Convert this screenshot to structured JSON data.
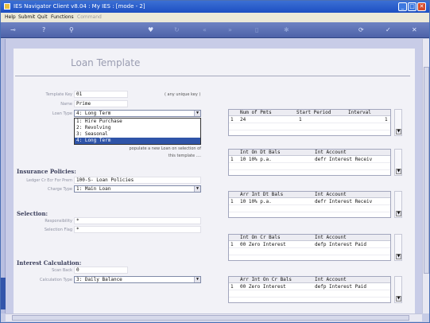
{
  "window": {
    "title": "IES Navigator Client v8.04 : My IES :      [mode - 2]"
  },
  "menu": {
    "items": [
      "Help",
      "Submit",
      "Quit",
      "Functions"
    ],
    "disabled_item": "Command"
  },
  "toolbar": {
    "icons": [
      "key-icon",
      "help-icon",
      "search-icon",
      "heart-icon",
      "cycle-icon",
      "back-icon",
      "forward-icon",
      "doc-icon",
      "pin-icon",
      "refresh-icon",
      "check-icon",
      "close-icon"
    ]
  },
  "page": {
    "heading": "Loan Template"
  },
  "fields": {
    "template_key_label": "Template Key",
    "template_key_value": "01",
    "template_key_hint": "( any unique key )",
    "name_label": "Name",
    "name_value": "Prime",
    "loan_type_label": "Loan Type",
    "loan_type_value": "4: Long Term",
    "loan_type_options": [
      "1: Hire Purchase",
      "2: Revolving",
      "3: Seasonal",
      "4: Long Term"
    ],
    "loan_type_note1": "populate a new Loan on selection of",
    "loan_type_note2": "this template ....",
    "insurance_heading": "Insurance Policies:",
    "ledger_label": "Ledger Cr Ecr For Prem",
    "ledger_value": "100-S- Loan Policies",
    "charge_type_label": "Charge Type",
    "charge_type_value": "1: Main Loan",
    "selection_heading": "Selection:",
    "responsibility_label": "Responsibility",
    "responsibility_value": "*",
    "selection_flag_label": "Selection Flag",
    "selection_flag_value": "*",
    "interest_heading": "Interest Calculation:",
    "scan_back_label": "Scan Back",
    "scan_back_value": "0",
    "calc_type_label": "Calculation Type",
    "calc_type_value": "3: Daily Balance"
  },
  "grids": [
    {
      "headers": [
        "Num of Pmts",
        "Start Period",
        "Interval"
      ],
      "rows": [
        [
          "1",
          "24",
          "1",
          "1"
        ]
      ]
    },
    {
      "headers": [
        "Int On Dt Bals",
        "Int Account"
      ],
      "rows": [
        [
          "1",
          "10 10% p.a.",
          "defr Interest Receiv"
        ]
      ]
    },
    {
      "headers": [
        "Arr Int Dt Bals",
        "Int Account"
      ],
      "rows": [
        [
          "1",
          "10 10% p.a.",
          "defr Interest Receiv"
        ]
      ]
    },
    {
      "headers": [
        "Int On Cr Bals",
        "Int Account"
      ],
      "rows": [
        [
          "1",
          "00 Zero Interest",
          "defp Interest Paid"
        ]
      ]
    },
    {
      "headers": [
        "Arr Int On Cr Bals",
        "Int Account"
      ],
      "rows": [
        [
          "1",
          "00 Zero Interest",
          "defp Interest Paid"
        ]
      ]
    }
  ]
}
